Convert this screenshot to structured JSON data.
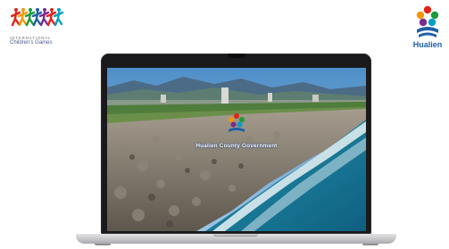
{
  "icg_logo": {
    "line1": "INTERNATIONAL",
    "line2": "Children's Games",
    "figure_colors": [
      "#e2231a",
      "#f39800",
      "#1d9a3a",
      "#1d5fa8",
      "#7b2a8f",
      "#e2231a",
      "#00a0c6"
    ]
  },
  "hualien_logo": {
    "text": "Hualien",
    "petal_colors": [
      "#e2231a",
      "#f39800",
      "#1d9a3a",
      "#1d5fa8",
      "#7b2a8f"
    ]
  },
  "laptop": {
    "video": {
      "caption": "Hualien County Government",
      "logo_name": "hualien-emblem"
    }
  }
}
